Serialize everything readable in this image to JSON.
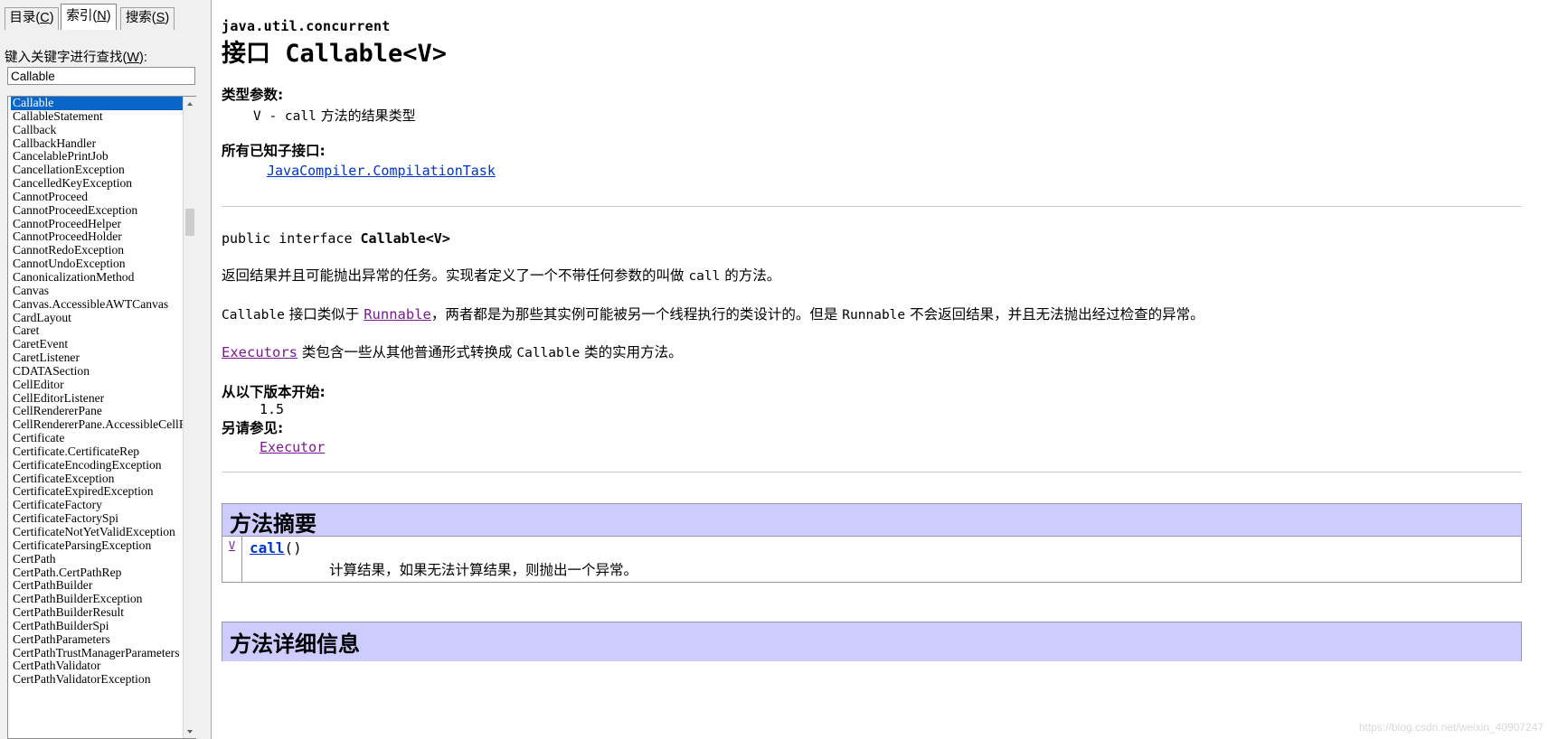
{
  "help_pane": {
    "tabs": [
      {
        "id": "contents",
        "label": "目录(C)",
        "active": false
      },
      {
        "id": "index",
        "label": "索引(N)",
        "active": true
      },
      {
        "id": "search",
        "label": "搜索(S)",
        "active": false
      }
    ],
    "keyword_label": "键入关键字进行查找(W):",
    "keyword_value": "Callable",
    "keyword_placeholder": "",
    "selected_index": 0,
    "selection_color": "#0a65c8",
    "list_items": [
      "Callable",
      "CallableStatement",
      "Callback",
      "CallbackHandler",
      "CancelablePrintJob",
      "CancellationException",
      "CancelledKeyException",
      "CannotProceed",
      "CannotProceedException",
      "CannotProceedHelper",
      "CannotProceedHolder",
      "CannotRedoException",
      "CannotUndoException",
      "CanonicalizationMethod",
      "Canvas",
      "Canvas.AccessibleAWTCanvas",
      "CardLayout",
      "Caret",
      "CaretEvent",
      "CaretListener",
      "CDATASection",
      "CellEditor",
      "CellEditorListener",
      "CellRendererPane",
      "CellRendererPane.AccessibleCellRe",
      "Certificate",
      "Certificate.CertificateRep",
      "CertificateEncodingException",
      "CertificateException",
      "CertificateExpiredException",
      "CertificateFactory",
      "CertificateFactorySpi",
      "CertificateNotYetValidException",
      "CertificateParsingException",
      "CertPath",
      "CertPath.CertPathRep",
      "CertPathBuilder",
      "CertPathBuilderException",
      "CertPathBuilderResult",
      "CertPathBuilderSpi",
      "CertPathParameters",
      "CertPathTrustManagerParameters",
      "CertPathValidator",
      "CertPathValidatorException"
    ]
  },
  "doc": {
    "package": "java.util.concurrent",
    "title": "接口 Callable<V>",
    "type_params_label": "类型参数:",
    "type_params_item": "V - call 方法的结果类型",
    "type_params_item_mono_prefix": "V - call",
    "type_params_item_cjk": " 方法的结果类型",
    "known_subinterfaces_label": "所有已知子接口:",
    "known_subinterfaces_link": "JavaCompiler.CompilationTask",
    "declaration_prefix": "public interface ",
    "declaration_name": "Callable<V>",
    "paragraph1_a": "返回结果并且可能抛出异常的任务。实现者定义了一个不带任何参数的叫做 ",
    "paragraph1_code": "call",
    "paragraph1_b": " 的方法。",
    "paragraph2_a": "Callable",
    "paragraph2_b": " 接口类似于 ",
    "paragraph2_link": "Runnable",
    "paragraph2_c": "，两者都是为那些其实例可能被另一个线程执行的类设计的。但是 ",
    "paragraph2_code2": "Runnable",
    "paragraph2_d": " 不会返回结果，并且无法抛出经过检查的异常。",
    "paragraph3_link": "Executors",
    "paragraph3_a": " 类包含一些从其他普通形式转换成 ",
    "paragraph3_code": "Callable",
    "paragraph3_b": " 类的实用方法。",
    "since_label": "从以下版本开始:",
    "since_value": "1.5",
    "see_also_label": "另请参见:",
    "see_also_link": "Executor",
    "method_summary_heading": "方法摘要",
    "method_detail_heading": "方法详细信息",
    "method_row": {
      "return_type": "V",
      "name": "call",
      "signature_suffix": "()",
      "description": "计算结果，如果无法计算结果，则抛出一个异常。"
    },
    "colors": {
      "section_header_bg": "#ccccff",
      "link": "#0033cc",
      "visited_link": "#7a1a8f",
      "border": "#9797b0"
    }
  },
  "watermark": "https://blog.csdn.net/weixin_40907247"
}
